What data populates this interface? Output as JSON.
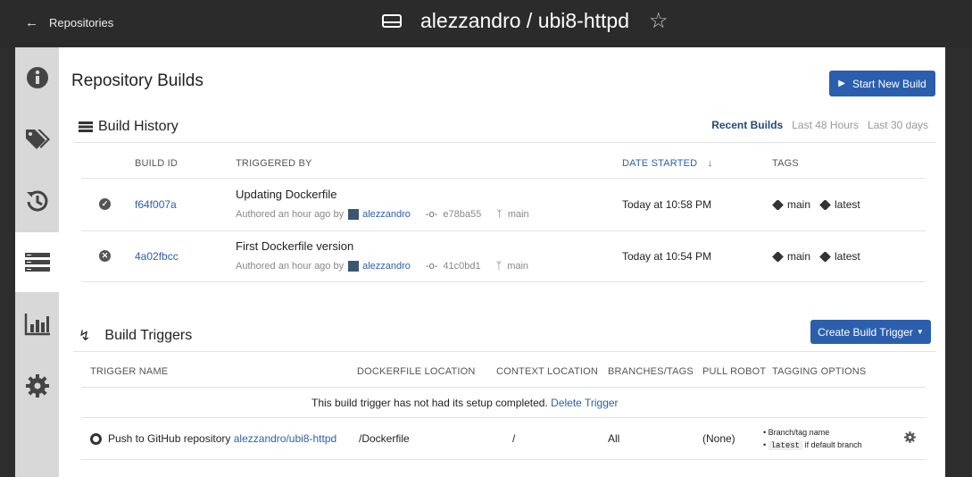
{
  "header": {
    "back_label": "Repositories",
    "repo_title": "alezzandro / ubi8-httpd"
  },
  "sidebar": {
    "items": [
      {
        "name": "info",
        "icon": "info-icon"
      },
      {
        "name": "tags",
        "icon": "tags-icon"
      },
      {
        "name": "history",
        "icon": "history-icon"
      },
      {
        "name": "builds",
        "icon": "builds-icon",
        "active": true
      },
      {
        "name": "usage",
        "icon": "bar-chart-icon"
      },
      {
        "name": "settings",
        "icon": "gear-icon"
      }
    ]
  },
  "main": {
    "title": "Repository Builds",
    "start_build_label": "Start New Build",
    "build_history": {
      "title": "Build History",
      "filters": [
        "Recent Builds",
        "Last 48 Hours",
        "Last 30 days"
      ],
      "columns": [
        "BUILD ID",
        "TRIGGERED BY",
        "DATE STARTED",
        "TAGS"
      ],
      "rows": [
        {
          "status": "complete",
          "build_id": "f64f007a",
          "message": "Updating Dockerfile",
          "authored": "Authored an hour ago by",
          "user": "alezzandro",
          "commit": "e78ba55",
          "branch": "main",
          "date": "Today at 10:58 PM",
          "tags": [
            "main",
            "latest"
          ]
        },
        {
          "status": "error",
          "build_id": "4a02fbcc",
          "message": "First Dockerfile version",
          "authored": "Authored an hour ago by",
          "user": "alezzandro",
          "commit": "41c0bd1",
          "branch": "main",
          "date": "Today at 10:54 PM",
          "tags": [
            "main",
            "latest"
          ]
        }
      ]
    },
    "build_triggers": {
      "title": "Build Triggers",
      "create_label": "Create Build Trigger",
      "columns": [
        "TRIGGER NAME",
        "DOCKERFILE LOCATION",
        "CONTEXT LOCATION",
        "BRANCHES/TAGS",
        "PULL ROBOT",
        "TAGGING OPTIONS"
      ],
      "notice": "This build trigger has not had its setup completed.",
      "delete_label": "Delete Trigger",
      "trigger": {
        "name_prefix": "Push to GitHub repository",
        "repo": "alezzandro/ubi8-httpd",
        "dockerfile": "/Dockerfile",
        "context": "/",
        "branches": "All",
        "robot": "(None)",
        "tagging_1": "Branch/tag name",
        "tagging_2_code": "latest",
        "tagging_2_text": "if default branch"
      }
    }
  },
  "colors": {
    "accent": "#2b5fad",
    "header_bg": "#2b2b2b",
    "sidebar_bg": "#d8d8d8"
  }
}
